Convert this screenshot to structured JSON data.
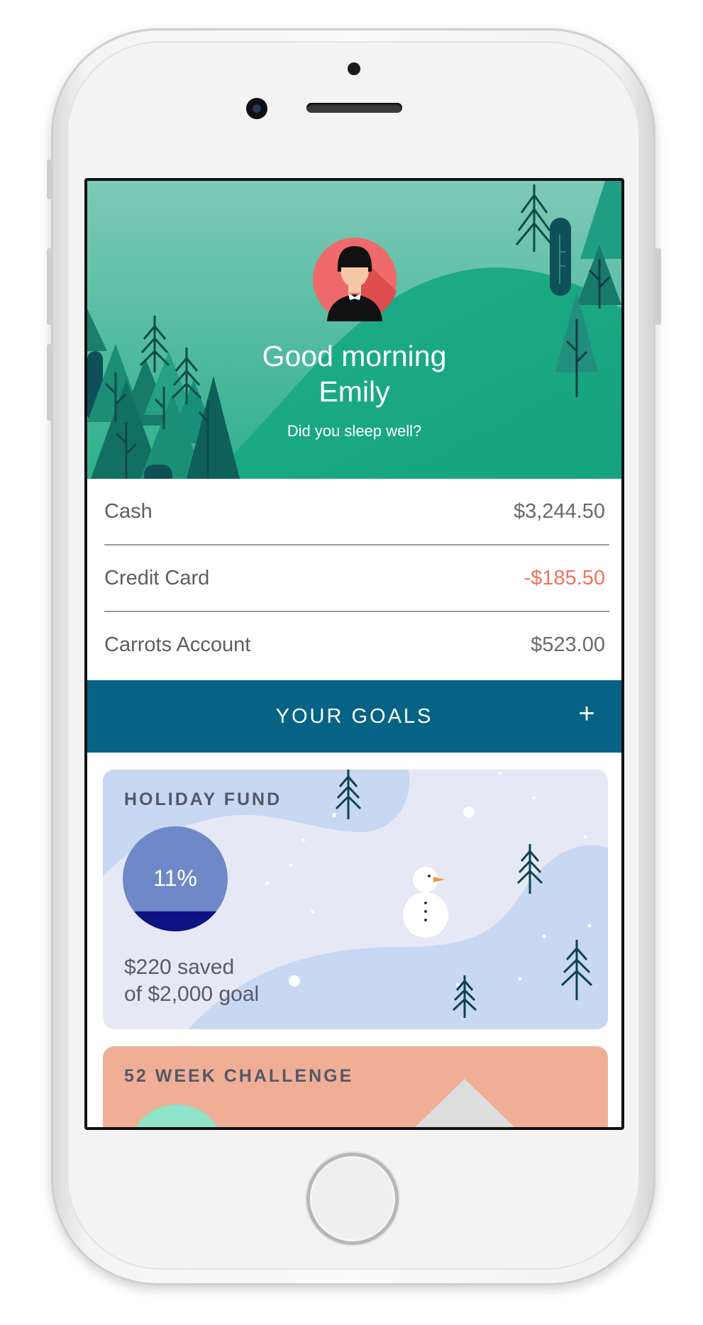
{
  "header": {
    "greeting_line1": "Good morning",
    "greeting_line2": "Emily",
    "subtitle": "Did you sleep well?"
  },
  "accounts": [
    {
      "name": "Cash",
      "amount": "$3,244.50",
      "negative": false
    },
    {
      "name": "Credit Card",
      "amount": "-$185.50",
      "negative": true
    },
    {
      "name": "Carrots Account",
      "amount": "$523.00",
      "negative": false
    }
  ],
  "goals_section": {
    "title": "YOUR GOALS",
    "add_label": "+"
  },
  "goals": [
    {
      "title": "HOLIDAY FUND",
      "progress_label": "11%",
      "progress": 0.11,
      "saved_line1": "$220 saved",
      "saved_line2": "of $2,000 goal"
    },
    {
      "title": "52 WEEK CHALLENGE"
    }
  ],
  "colors": {
    "header_green": "#3dbb9a",
    "goals_bar": "#066385",
    "negative_amount": "#f0735c",
    "holiday_card_bg": "#e6e8f6",
    "challenge_card_bg": "#f0ae96"
  }
}
